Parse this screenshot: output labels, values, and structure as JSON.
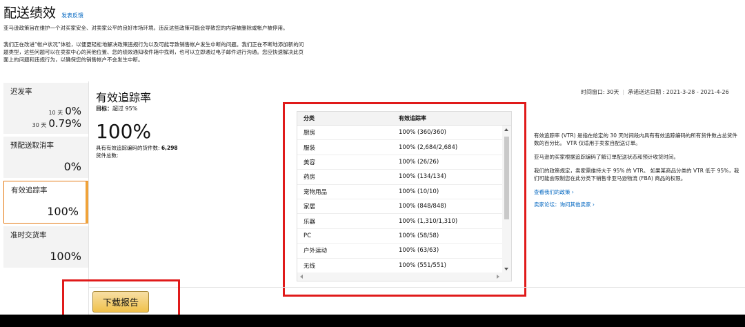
{
  "header": {
    "title": "配送绩效",
    "feedback_link": "发表反馈",
    "para1": "亚马逊政策旨在维护一个对买家安全、对卖家公平的良好市场环境。违反这些政策可能会导致您的内容被删除或帐户被停用。",
    "para2": "我们正在改进“帐户状况”体验，以便更轻松地解决政策违规行为以及可能导致销售帐户发生中断的问题。我们正在不断地添加新的问题类型，这些问题可以在卖家中心的其他位置、您的绩效通知收件箱中找到，也可以立即通过电子邮件进行沟通。您应快速解决此页面上的问题和违规行为，以确保您的销售帐户不会发生中断。"
  },
  "sidebar": {
    "late": {
      "label": "迟发率",
      "d10_label": "10 天",
      "d10_value": "0%",
      "d30_label": "30 天",
      "d30_value": "0.79%"
    },
    "cancel": {
      "label": "预配送取消率",
      "value": "0%"
    },
    "tracking": {
      "label": "有效追踪率",
      "value": "100%"
    },
    "ontime": {
      "label": "准时交货率",
      "value": "100%"
    }
  },
  "detail": {
    "title": "有效追踪率",
    "goal_label": "目标：",
    "goal_value": "超过 95%",
    "value": "100%",
    "note_prefix": "具有有效追踪编码的货件数:",
    "note_count": "6,298",
    "note_suffix": "货件总数:"
  },
  "time": {
    "window": "时间窗口: 30天",
    "range": "承诺送达日期 : 2021-3-28 - 2021-4-26"
  },
  "table": {
    "col1": "分类",
    "col2": "有效追踪率",
    "rows": [
      {
        "cat": "厨房",
        "rate": "100% (360/360)"
      },
      {
        "cat": "服装",
        "rate": "100% (2,684/2,684)"
      },
      {
        "cat": "美容",
        "rate": "100% (26/26)"
      },
      {
        "cat": "药房",
        "rate": "100% (134/134)"
      },
      {
        "cat": "宠物用品",
        "rate": "100% (10/10)"
      },
      {
        "cat": "家居",
        "rate": "100% (848/848)"
      },
      {
        "cat": "乐器",
        "rate": "100% (1,310/1,310)"
      },
      {
        "cat": "PC",
        "rate": "100% (58/58)"
      },
      {
        "cat": "户外运动",
        "rate": "100% (63/63)"
      },
      {
        "cat": "无线",
        "rate": "100% (551/551)"
      }
    ]
  },
  "info": {
    "p1": "有效追踪率 (VTR) 是指在给定的 30 天时间段内具有有效追踪编码的所有货件数占总货件数的百分比。 VTR 仅适用于卖家自配送订单。",
    "p2": "亚马逊的买家根据追踪编码了解订单配送状态和预计收货时间。",
    "p3": "我们的政策规定，卖家需维持大于 95% 的 VTR。 如果某商品分类的 VTR 低于 95%，我们可能会限制您在此分类下销售非亚马逊物流 (FBA) 商品的权限。",
    "link1": "查看我们的政策 ›",
    "link2": "卖家论坛：询问其他卖家 ›"
  },
  "download_button": "下载报告",
  "colors": {
    "accent": "#e47911",
    "link": "#0066c0",
    "highlight_red": "#e01a1a",
    "button": "#f0c14b"
  }
}
